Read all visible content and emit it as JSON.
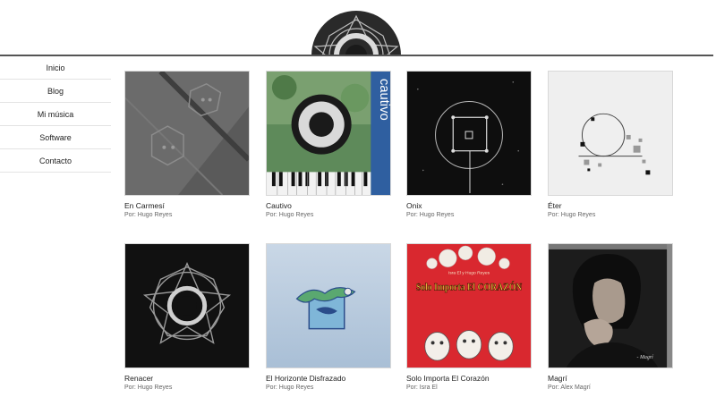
{
  "header": {
    "logo": "mandala-logo"
  },
  "sidebar": {
    "items": [
      {
        "label": "Inicio"
      },
      {
        "label": "Blog"
      },
      {
        "label": "Mi música"
      },
      {
        "label": "Software"
      },
      {
        "label": "Contacto"
      }
    ]
  },
  "albums": [
    {
      "title": "En Carmesí",
      "by_prefix": "Por:",
      "artist": "Hugo Reyes"
    },
    {
      "title": "Cautivo",
      "by_prefix": "Por:",
      "artist": "Hugo Reyes",
      "cover_text": "cautivo"
    },
    {
      "title": "Onix",
      "by_prefix": "Por:",
      "artist": "Hugo Reyes"
    },
    {
      "title": "Éter",
      "by_prefix": "Por:",
      "artist": "Hugo Reyes"
    },
    {
      "title": "Renacer",
      "by_prefix": "Por:",
      "artist": "Hugo Reyes"
    },
    {
      "title": "El Horizonte Disfrazado",
      "by_prefix": "Por:",
      "artist": "Hugo Reyes"
    },
    {
      "title": "Solo Importa El Corazón",
      "by_prefix": "Por:",
      "artist": "Isra El",
      "cover_text": "Solo Importa El CORAZÓN",
      "cover_subtext": "Isra El y Hugo Reyes"
    },
    {
      "title": "Magrí",
      "by_prefix": "Por:",
      "artist": "Alex Magrí",
      "cover_text": "- Magrí"
    }
  ]
}
